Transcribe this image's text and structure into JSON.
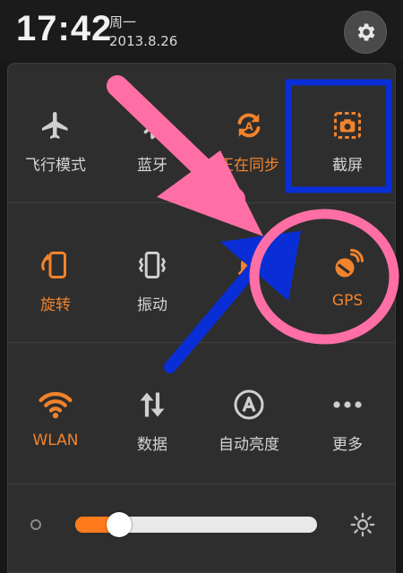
{
  "status_bar": {
    "time": "17:42",
    "weekday": "周一",
    "date": "2013.8.26",
    "settings_icon": "gear-icon"
  },
  "toggles": [
    {
      "label": "飞行模式",
      "icon": "airplane-icon",
      "on": false
    },
    {
      "label": "蓝牙",
      "icon": "bluetooth-icon",
      "on": false
    },
    {
      "label": "正在同步",
      "icon": "sync-icon",
      "on": true
    },
    {
      "label": "截屏",
      "icon": "screenshot-icon",
      "on": false
    },
    {
      "label": "旋转",
      "icon": "rotate-icon",
      "on": true
    },
    {
      "label": "振动",
      "icon": "vibrate-icon",
      "on": false
    },
    {
      "label": "",
      "icon": "silent-icon",
      "on": true
    },
    {
      "label": "GPS",
      "icon": "gps-icon",
      "on": true
    },
    {
      "label": "WLAN",
      "icon": "wifi-icon",
      "on": true
    },
    {
      "label": "数据",
      "icon": "mobile-data-icon",
      "on": false
    },
    {
      "label": "自动亮度",
      "icon": "auto-brightness-icon",
      "on": false
    },
    {
      "label": "更多",
      "icon": "more-icon",
      "on": false
    }
  ],
  "brightness": {
    "level": 0.18,
    "low_icon": "brightness-low-icon",
    "high_icon": "brightness-high-icon"
  },
  "colors": {
    "accent": "#f2832b",
    "annotation_pink": "#ff6fa5",
    "annotation_blue": "#0a2ed6"
  }
}
